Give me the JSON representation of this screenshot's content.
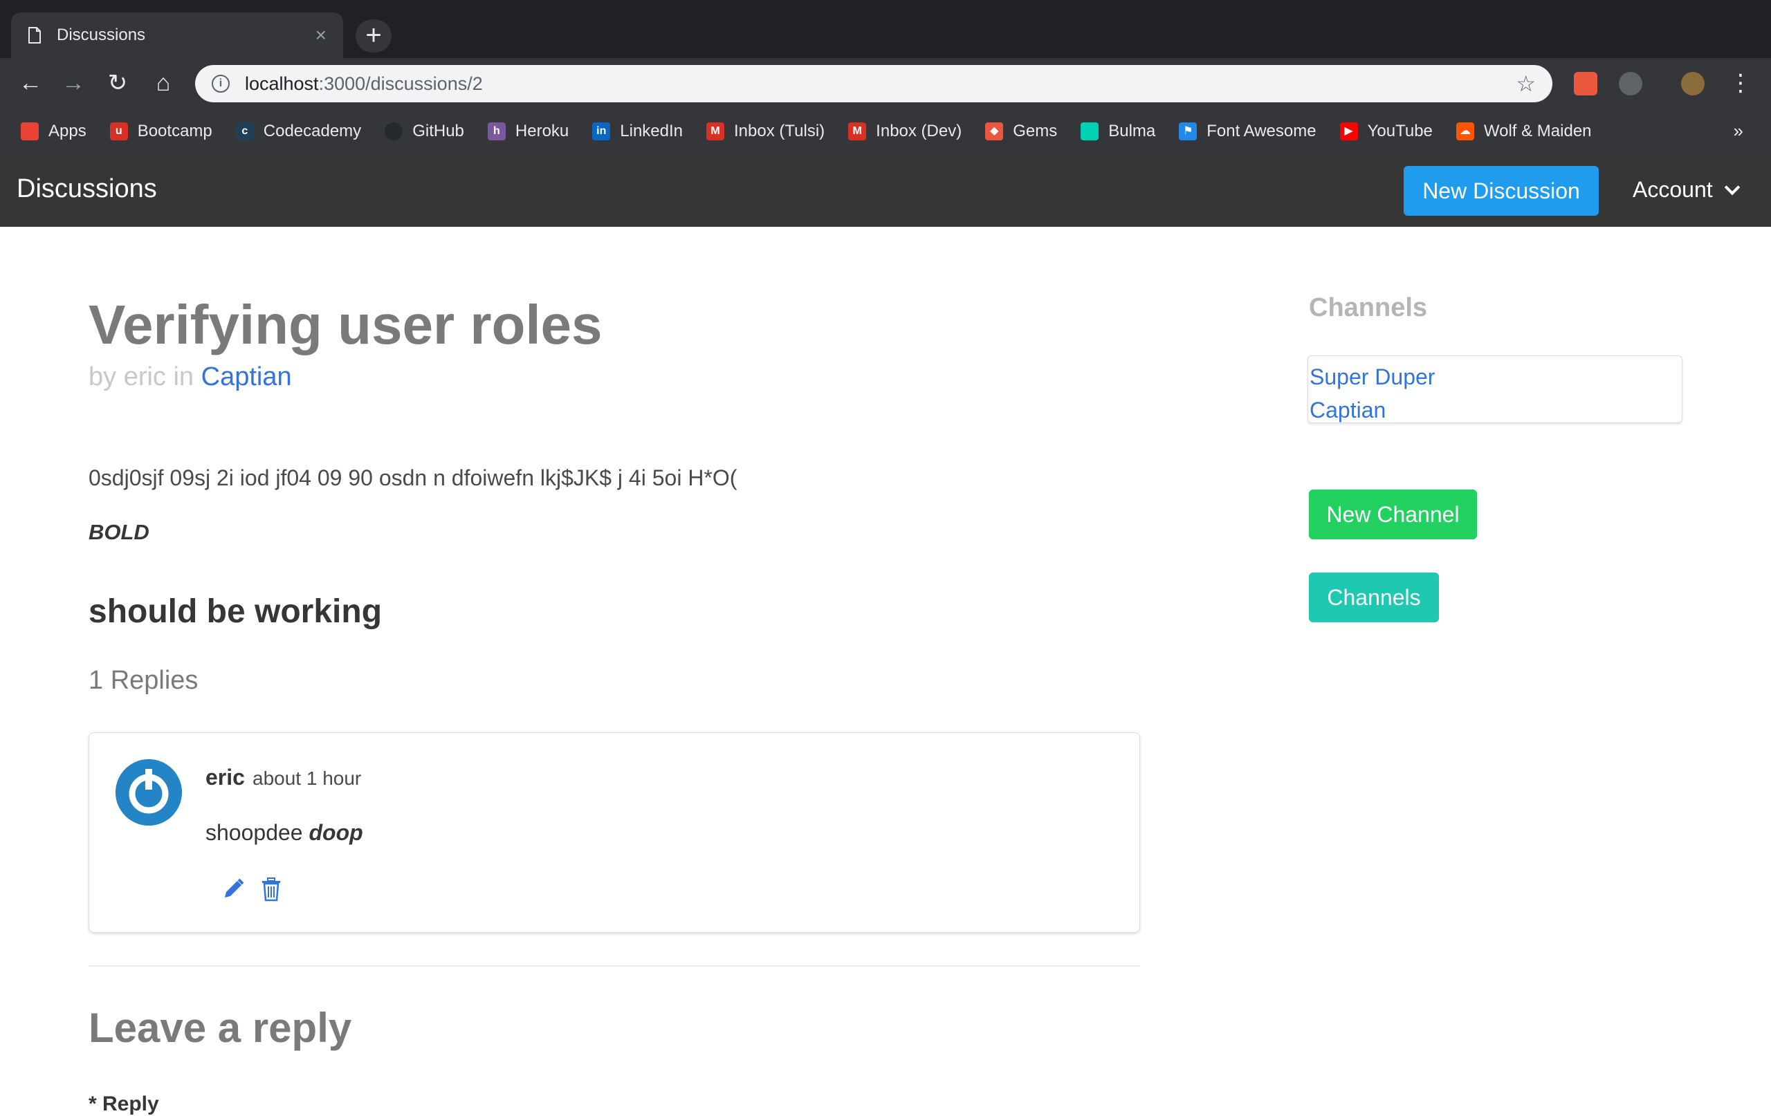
{
  "browser": {
    "tab_title": "Discussions",
    "tab_close": "×",
    "new_tab": "+",
    "url_host": "localhost",
    "url_path": ":3000/discussions/2",
    "bookmarks": [
      {
        "label": "Apps",
        "icon": "apps-grid-icon",
        "color": "#ea4335"
      },
      {
        "label": "Bootcamp",
        "icon": "bootcamp-icon",
        "color": "#d93025"
      },
      {
        "label": "Codecademy",
        "icon": "codecademy-icon",
        "color": "#1f4056"
      },
      {
        "label": "GitHub",
        "icon": "github-icon",
        "color": "#24292e"
      },
      {
        "label": "Heroku",
        "icon": "heroku-icon",
        "color": "#79589f"
      },
      {
        "label": "LinkedIn",
        "icon": "linkedin-icon",
        "color": "#0a66c2"
      },
      {
        "label": "Inbox (Tulsi)",
        "icon": "gmail-icon",
        "color": "#d93025"
      },
      {
        "label": "Inbox (Dev)",
        "icon": "gmail-icon",
        "color": "#d93025"
      },
      {
        "label": "Gems",
        "icon": "rubygems-icon",
        "color": "#e9573f"
      },
      {
        "label": "Bulma",
        "icon": "bulma-icon",
        "color": "#00d1b2"
      },
      {
        "label": "Font Awesome",
        "icon": "font-awesome-icon",
        "color": "#228ae6"
      },
      {
        "label": "YouTube",
        "icon": "youtube-icon",
        "color": "#ff0000"
      },
      {
        "label": "Wolf & Maiden",
        "icon": "soundcloud-icon",
        "color": "#ff5500"
      }
    ],
    "bookmarks_more": "»"
  },
  "navbar": {
    "brand": "Discussions",
    "new_discussion": "New Discussion",
    "account": "Account"
  },
  "discussion": {
    "title": "Verifying user roles",
    "by_prefix": "by eric in",
    "channel": "Captian",
    "body_line": "0sdj0sjf 09sj 2i iod jf04 09 90 osdn n dfoiwefn lkj$JK$ j 4i 5oi H*O(",
    "body_bold": "BOLD",
    "body_heading": "should be working",
    "replies_count": "1 Replies"
  },
  "reply": {
    "author": "eric",
    "time": "about 1 hour",
    "text_plain": "shoopdee",
    "text_bold": "doop"
  },
  "leave_reply": {
    "heading": "Leave a reply",
    "label": "* Reply"
  },
  "sidebar": {
    "heading": "Channels",
    "channels": [
      "Super Duper",
      "Captian"
    ],
    "new_channel": "New Channel",
    "channels_button": "Channels"
  },
  "colors": {
    "primary": "#3273dc",
    "info": "#209cee",
    "success": "#23d160",
    "turquoise": "#1fc8b0",
    "navbar": "#363636"
  }
}
